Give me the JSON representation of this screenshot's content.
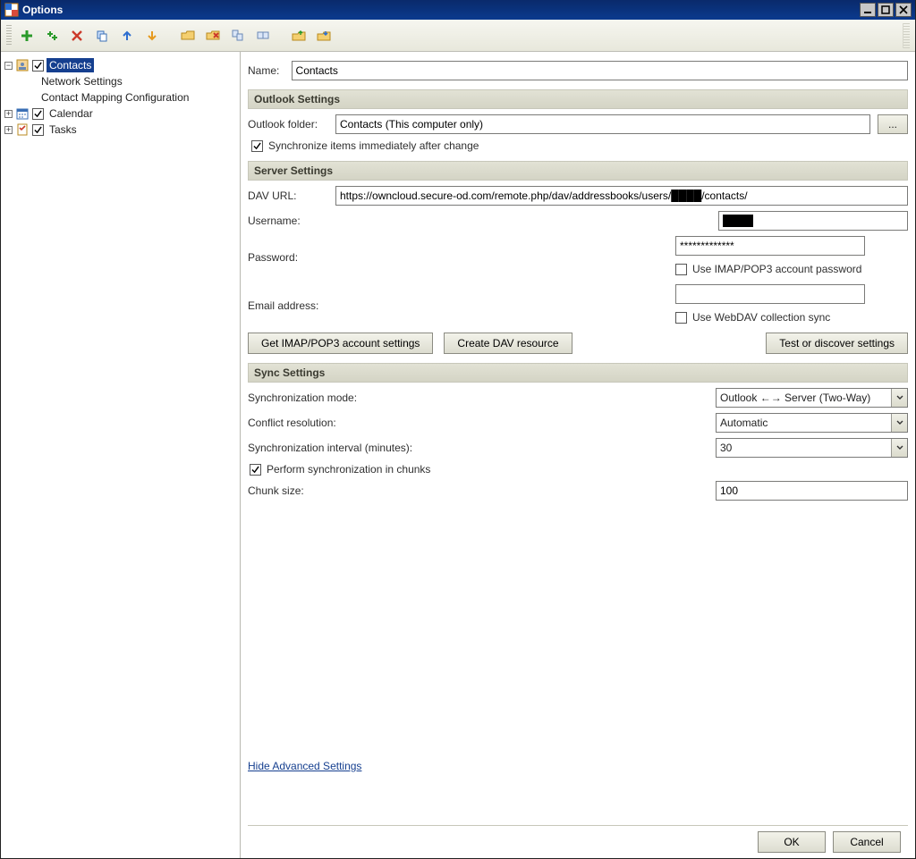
{
  "window": {
    "title": "Options"
  },
  "tree": {
    "contacts": {
      "label": "Contacts",
      "checked": true,
      "expanded": true,
      "children": [
        {
          "label": "Network Settings"
        },
        {
          "label": "Contact Mapping Configuration"
        }
      ]
    },
    "calendar": {
      "label": "Calendar",
      "checked": true,
      "expanded": false
    },
    "tasks": {
      "label": "Tasks",
      "checked": true,
      "expanded": false
    }
  },
  "name_row": {
    "label": "Name:",
    "value": "Contacts"
  },
  "sections": {
    "outlook": {
      "title": "Outlook Settings"
    },
    "server": {
      "title": "Server Settings"
    },
    "sync": {
      "title": "Sync Settings"
    }
  },
  "outlook": {
    "folder_label": "Outlook folder:",
    "folder_value": "Contacts (This computer only)",
    "browse_label": "...",
    "sync_immediately_label": "Synchronize items immediately after change",
    "sync_immediately_checked": true
  },
  "server": {
    "dav_label": "DAV URL:",
    "dav_value": "https://owncloud.secure-od.com/remote.php/dav/addressbooks/users/████/contacts/",
    "username_label": "Username:",
    "username_value": "████",
    "password_label": "Password:",
    "password_value": "*************",
    "use_imap_pwd_label": "Use IMAP/POP3 account password",
    "use_imap_pwd_checked": false,
    "email_label": "Email address:",
    "email_value": "",
    "use_webdav_sync_label": "Use WebDAV collection sync",
    "use_webdav_sync_checked": false,
    "btn_get_imap": "Get IMAP/POP3 account settings",
    "btn_create_dav": "Create DAV resource",
    "btn_test": "Test or discover settings"
  },
  "sync": {
    "mode_label": "Synchronization mode:",
    "mode_value": "Outlook ←→ Server (Two-Way)",
    "conflict_label": "Conflict resolution:",
    "conflict_value": "Automatic",
    "interval_label": "Synchronization interval (minutes):",
    "interval_value": "30",
    "chunks_label": "Perform synchronization in chunks",
    "chunks_checked": true,
    "chunk_size_label": "Chunk size:",
    "chunk_size_value": "100"
  },
  "advanced_link": "Hide Advanced Settings",
  "footer": {
    "ok": "OK",
    "cancel": "Cancel"
  }
}
